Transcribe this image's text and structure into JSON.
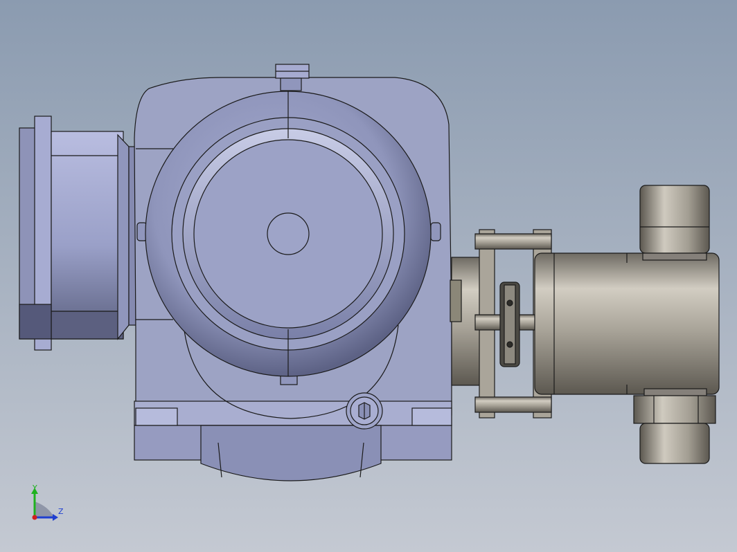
{
  "viewport": {
    "background_top": "#8b9bb0",
    "background_bottom": "#c4c9d2"
  },
  "model": {
    "body_color": "#9da3c4",
    "body_dark": "#6e7496",
    "body_light": "#c5c9e0",
    "pump_color": "#9a9488",
    "pump_light": "#cdc8bd",
    "pump_dark": "#5e5a52",
    "edge_color": "#1a1a1a"
  },
  "triad": {
    "y_label": "Y",
    "z_label": "Z",
    "y_color": "#1fb21f",
    "z_color": "#1f3fd0",
    "x_color": "#d01f1f"
  }
}
